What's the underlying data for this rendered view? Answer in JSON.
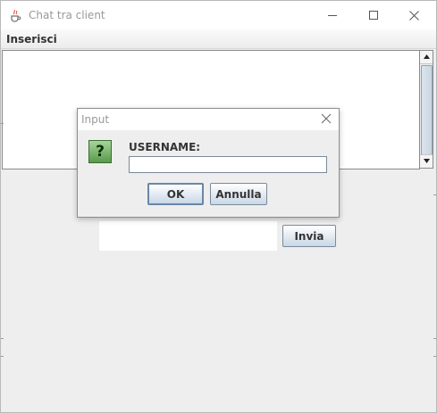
{
  "window": {
    "title": "Chat tra client",
    "controls": [
      "minimize-icon",
      "maximize-icon",
      "close-icon"
    ]
  },
  "menubar": {
    "items": [
      {
        "label": "Inserisci"
      }
    ]
  },
  "chat": {
    "message_value": "",
    "send_label": "Invia"
  },
  "dialog": {
    "title": "Input",
    "icon": "question-icon",
    "icon_glyph": "?",
    "prompt": "USERNAME:",
    "field_value": "",
    "ok_label": "OK",
    "cancel_label": "Annulla"
  },
  "colors": {
    "button_gradient_top": "#ffffff",
    "button_gradient_bottom": "#c9d7e6",
    "question_icon": "#5a9a4c"
  }
}
